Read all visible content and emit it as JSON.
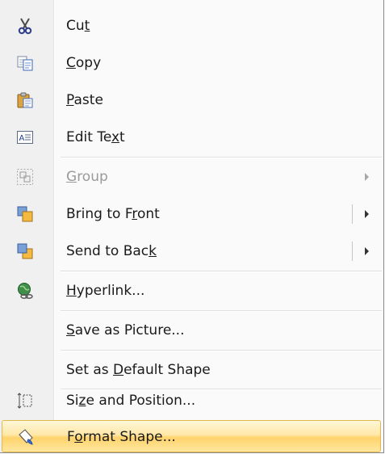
{
  "menu": {
    "items": [
      {
        "id": "cut",
        "pre": "Cu",
        "mnemonic": "t",
        "post": "",
        "icon": "scissors-icon"
      },
      {
        "id": "copy",
        "pre": "",
        "mnemonic": "C",
        "post": "opy",
        "icon": "copy-icon"
      },
      {
        "id": "paste",
        "pre": "",
        "mnemonic": "P",
        "post": "aste",
        "icon": "paste-icon"
      },
      {
        "id": "edit-text",
        "pre": "Edit Te",
        "mnemonic": "x",
        "post": "t",
        "icon": "edit-text-icon"
      },
      {
        "id": "group",
        "pre": "",
        "mnemonic": "G",
        "post": "roup",
        "icon": "group-icon",
        "disabled": true,
        "submenu": true
      },
      {
        "id": "bring-to-front",
        "pre": "Bring to F",
        "mnemonic": "r",
        "post": "ont",
        "icon": "bring-to-front-icon",
        "submenu": true
      },
      {
        "id": "send-to-back",
        "pre": "Send to Bac",
        "mnemonic": "k",
        "post": "",
        "icon": "send-to-back-icon",
        "submenu": true
      },
      {
        "id": "hyperlink",
        "pre": "",
        "mnemonic": "H",
        "post": "yperlink...",
        "icon": "hyperlink-icon"
      },
      {
        "id": "save-as-picture",
        "pre": "",
        "mnemonic": "S",
        "post": "ave as Picture..."
      },
      {
        "id": "set-default-shape",
        "pre": "Set as ",
        "mnemonic": "D",
        "post": "efault Shape"
      },
      {
        "id": "size-and-position",
        "pre": "Si",
        "mnemonic": "z",
        "post": "e and Position...",
        "icon": "size-position-icon"
      },
      {
        "id": "format-shape",
        "pre": "F",
        "mnemonic": "o",
        "post": "rmat Shape...",
        "icon": "format-shape-icon",
        "highlighted": true
      }
    ]
  },
  "colors": {
    "highlight_top": "#fff7d8",
    "highlight_bottom": "#ffd36c",
    "highlight_border": "#e5b84d",
    "disabled_text": "#9a9a9a"
  }
}
